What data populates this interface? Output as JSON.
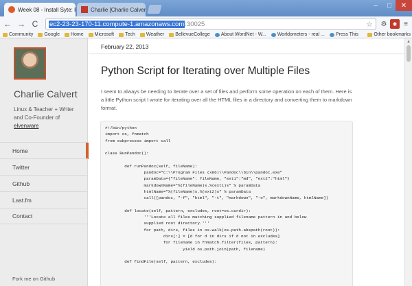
{
  "browser": {
    "tabs": [
      {
        "title": "Week 08 - Install Syte: PR",
        "close": "×"
      },
      {
        "title": "Charlie [Charlie Calvert]",
        "close": "×"
      }
    ],
    "window_controls": {
      "min": "–",
      "max": "□",
      "close": "✕"
    },
    "nav": {
      "back": "←",
      "forward": "→",
      "reload": "C",
      "home": "⌂"
    },
    "url": {
      "host": "ec2-23-23-170-11.compute-1.amazonaws.com",
      "port": ":30025"
    },
    "star": "☆",
    "extensions": [
      "⚙",
      "✱",
      "≡"
    ],
    "bookmarks": [
      {
        "label": "Community",
        "icon": "folder"
      },
      {
        "label": "Google",
        "icon": "folder"
      },
      {
        "label": "Home",
        "icon": "folder"
      },
      {
        "label": "Microsoft",
        "icon": "folder"
      },
      {
        "label": "Tech",
        "icon": "folder"
      },
      {
        "label": "Weather",
        "icon": "folder"
      },
      {
        "label": "BellevueCollege",
        "icon": "folder"
      },
      {
        "label": "About WordNet - W...",
        "icon": "globe"
      },
      {
        "label": "Worldometers - real ...",
        "icon": "globe"
      },
      {
        "label": "Press This",
        "icon": "globe"
      }
    ],
    "other_bookmarks": "Other bookmarks"
  },
  "sidebar": {
    "name": "Charlie Calvert",
    "tagline": "Linux & Teacher + Writer and Co-Founder of",
    "tagline_link": "elvenware",
    "menu": [
      {
        "label": "Home",
        "active": true
      },
      {
        "label": "Twitter",
        "active": false
      },
      {
        "label": "Github",
        "active": false
      },
      {
        "label": "Last.fm",
        "active": false
      },
      {
        "label": "Contact",
        "active": false
      }
    ],
    "fork": "Fork me on Github",
    "accent_color": "#d4602c"
  },
  "post": {
    "date": "February 22, 2013",
    "title": "Python Script for Iterating over Multiple Files",
    "intro": "I seem to always be needing to iterate over a set of files and perform some operation on each of them. Here is a little Python script I wrote for iterating over all the HTML files in a directory and converting them to markdown format.",
    "code": "#!/bin/python\nimport os, fnmatch\nfrom subprocess import call\n\nclass RunPandoc():\n\n        def runPandoc(self, fileName):\n                pandoc=\"C:\\\\Program Files (x86)\\\\Pandoc\\\\bin\\\\pandoc.exe\"\n                paramData={\"fileName\": fileName, \"ext1\":\"md\", \"ext2\":\"html\"}\n                markdownName=\"%(fileName)s.%(ext1)s\" % paramData\n                htmlName=\"%(fileName)s.%(ext2)s\" % paramData\n                call([pandoc, \"-f\", \"html\", \"-t\", \"markdown\", \"-o\", markdownName, htmlName])\n\n        def locate(self, pattern, excludes, root=os.curdir):\n                '''Locate all files matching supplied filename pattern in and below\n                supplied root directory.'''\n                for path, dirs, files in os.walk(os.path.abspath(root)):\n                        dirs[:] = [d for d in dirs if d not in excludes]\n                        for filename in fnmatch.filter(files, pattern):\n                                yield os.path.join(path, filename)\n\n        def findFile(self, pattern, excludes):"
  }
}
